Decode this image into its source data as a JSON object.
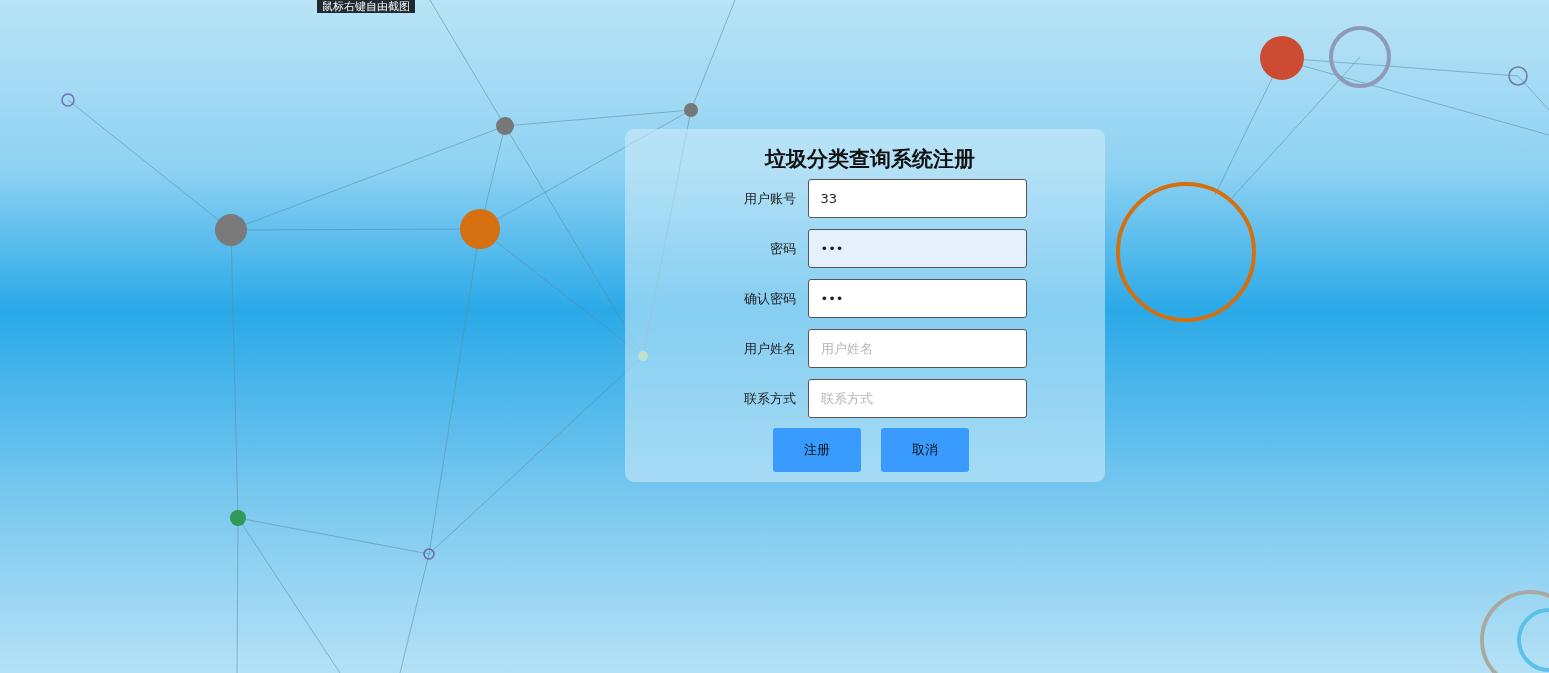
{
  "tooltip": "鼠标右键自由截图",
  "form": {
    "title": "垃圾分类查询系统注册",
    "fields": [
      {
        "label": "用户账号",
        "value": "33",
        "highlighted": false
      },
      {
        "label": "密码",
        "value": "•••",
        "highlighted": true
      },
      {
        "label": "确认密码",
        "value": "•••",
        "highlighted": false
      },
      {
        "label": "用户姓名",
        "placeholder": "用户姓名",
        "highlighted": false
      },
      {
        "label": "联系方式",
        "placeholder": "联系方式",
        "highlighted": false
      }
    ],
    "buttons": [
      "注册",
      "取消"
    ]
  }
}
